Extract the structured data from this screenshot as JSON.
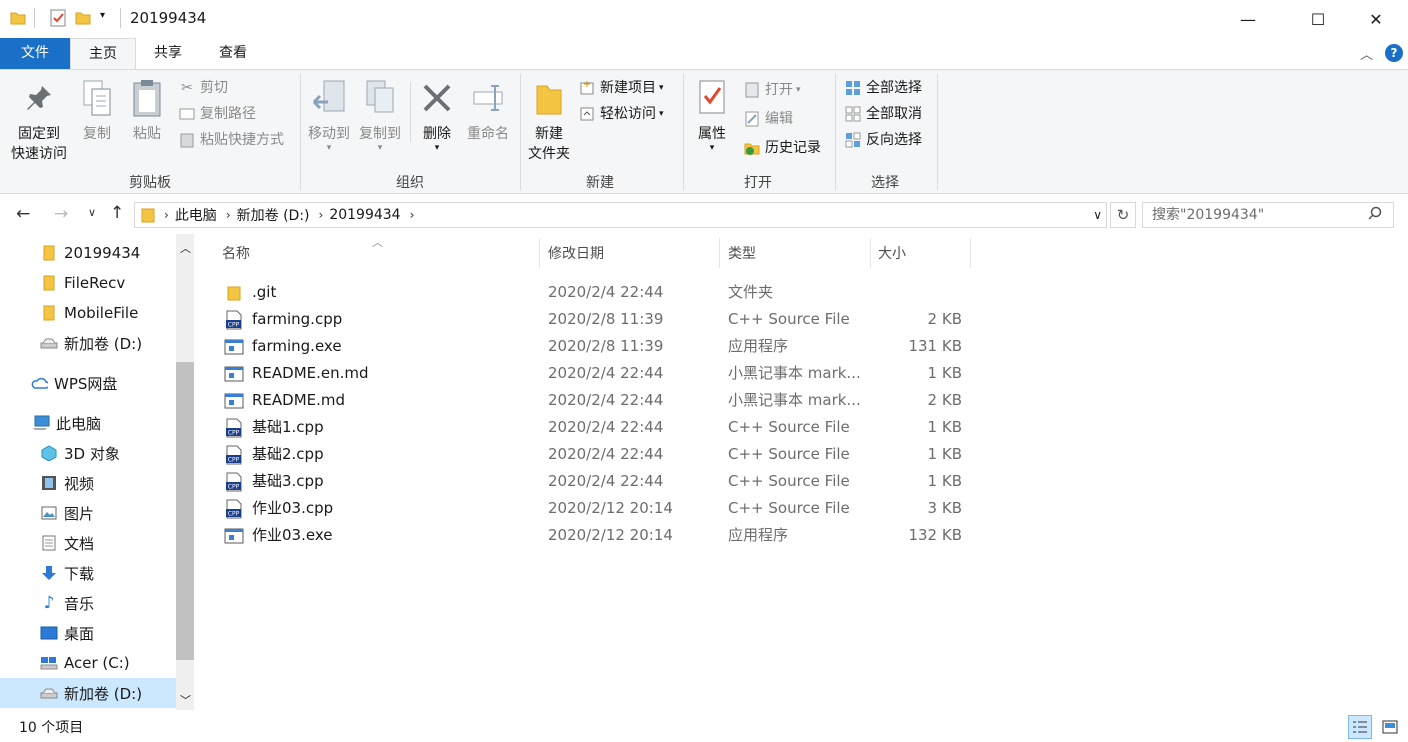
{
  "window": {
    "title": "20199434",
    "minimize": "—",
    "maximize": "☐",
    "close": "✕"
  },
  "tabs": {
    "file": "文件",
    "home": "主页",
    "share": "共享",
    "view": "查看"
  },
  "ribbon": {
    "clipboard": {
      "group": "剪贴板",
      "pin_line1": "固定到",
      "pin_line2": "快速访问",
      "copy": "复制",
      "paste": "粘贴",
      "cut": "剪切",
      "copy_path": "复制路径",
      "paste_shortcut": "粘贴快捷方式"
    },
    "organize": {
      "group": "组织",
      "move_to": "移动到",
      "copy_to": "复制到",
      "delete": "删除",
      "rename": "重命名"
    },
    "new": {
      "group": "新建",
      "folder_line1": "新建",
      "folder_line2": "文件夹",
      "new_item": "新建项目",
      "easy_access": "轻松访问"
    },
    "open": {
      "group": "打开",
      "properties": "属性",
      "open": "打开",
      "edit": "编辑",
      "history": "历史记录"
    },
    "select": {
      "group": "选择",
      "select_all": "全部选择",
      "select_none": "全部取消",
      "invert": "反向选择"
    }
  },
  "address": {
    "crumbs": [
      "此电脑",
      "新加卷 (D:)",
      "20199434"
    ],
    "search_placeholder": "搜索\"20199434\""
  },
  "nav": {
    "items": [
      {
        "label": "20199434",
        "icon": "folder-icon"
      },
      {
        "label": "FileRecv",
        "icon": "folder-icon"
      },
      {
        "label": "MobileFile",
        "icon": "folder-icon"
      },
      {
        "label": "新加卷 (D:)",
        "icon": "drive-icon"
      },
      {
        "label": "WPS网盘",
        "icon": "cloud-icon"
      },
      {
        "label": "此电脑",
        "icon": "computer-icon"
      },
      {
        "label": "3D 对象",
        "icon": "3d-icon"
      },
      {
        "label": "视频",
        "icon": "video-icon"
      },
      {
        "label": "图片",
        "icon": "picture-icon"
      },
      {
        "label": "文档",
        "icon": "document-icon"
      },
      {
        "label": "下载",
        "icon": "download-icon"
      },
      {
        "label": "音乐",
        "icon": "music-icon"
      },
      {
        "label": "桌面",
        "icon": "desktop-icon"
      },
      {
        "label": "Acer (C:)",
        "icon": "drive-icon"
      },
      {
        "label": "新加卷 (D:)",
        "icon": "drive-icon"
      }
    ]
  },
  "columns": {
    "name": "名称",
    "date": "修改日期",
    "type": "类型",
    "size": "大小"
  },
  "files": [
    {
      "name": ".git",
      "date": "2020/2/4 22:44",
      "type": "文件夹",
      "size": "",
      "icon": "folder-icon"
    },
    {
      "name": "farming.cpp",
      "date": "2020/2/8 11:39",
      "type": "C++ Source File",
      "size": "2 KB",
      "icon": "cpp-file-icon"
    },
    {
      "name": "farming.exe",
      "date": "2020/2/8 11:39",
      "type": "应用程序",
      "size": "131 KB",
      "icon": "exe-file-icon"
    },
    {
      "name": "README.en.md",
      "date": "2020/2/4 22:44",
      "type": "小黑记事本 mark...",
      "size": "1 KB",
      "icon": "md-file-icon"
    },
    {
      "name": "README.md",
      "date": "2020/2/4 22:44",
      "type": "小黑记事本 mark...",
      "size": "2 KB",
      "icon": "md-file-icon"
    },
    {
      "name": "基础1.cpp",
      "date": "2020/2/4 22:44",
      "type": "C++ Source File",
      "size": "1 KB",
      "icon": "cpp-file-icon"
    },
    {
      "name": "基础2.cpp",
      "date": "2020/2/4 22:44",
      "type": "C++ Source File",
      "size": "1 KB",
      "icon": "cpp-file-icon"
    },
    {
      "name": "基础3.cpp",
      "date": "2020/2/4 22:44",
      "type": "C++ Source File",
      "size": "1 KB",
      "icon": "cpp-file-icon"
    },
    {
      "name": "作业03.cpp",
      "date": "2020/2/12 20:14",
      "type": "C++ Source File",
      "size": "3 KB",
      "icon": "cpp-file-icon"
    },
    {
      "name": "作业03.exe",
      "date": "2020/2/12 20:14",
      "type": "应用程序",
      "size": "132 KB",
      "icon": "exe-file-icon"
    }
  ],
  "status": {
    "count": "10 个项目"
  },
  "colors": {
    "accent": "#1a6fc6",
    "folder": "#f4c542",
    "ribbon_bg": "#f5f6f7",
    "selected_nav": "#cce8ff"
  }
}
